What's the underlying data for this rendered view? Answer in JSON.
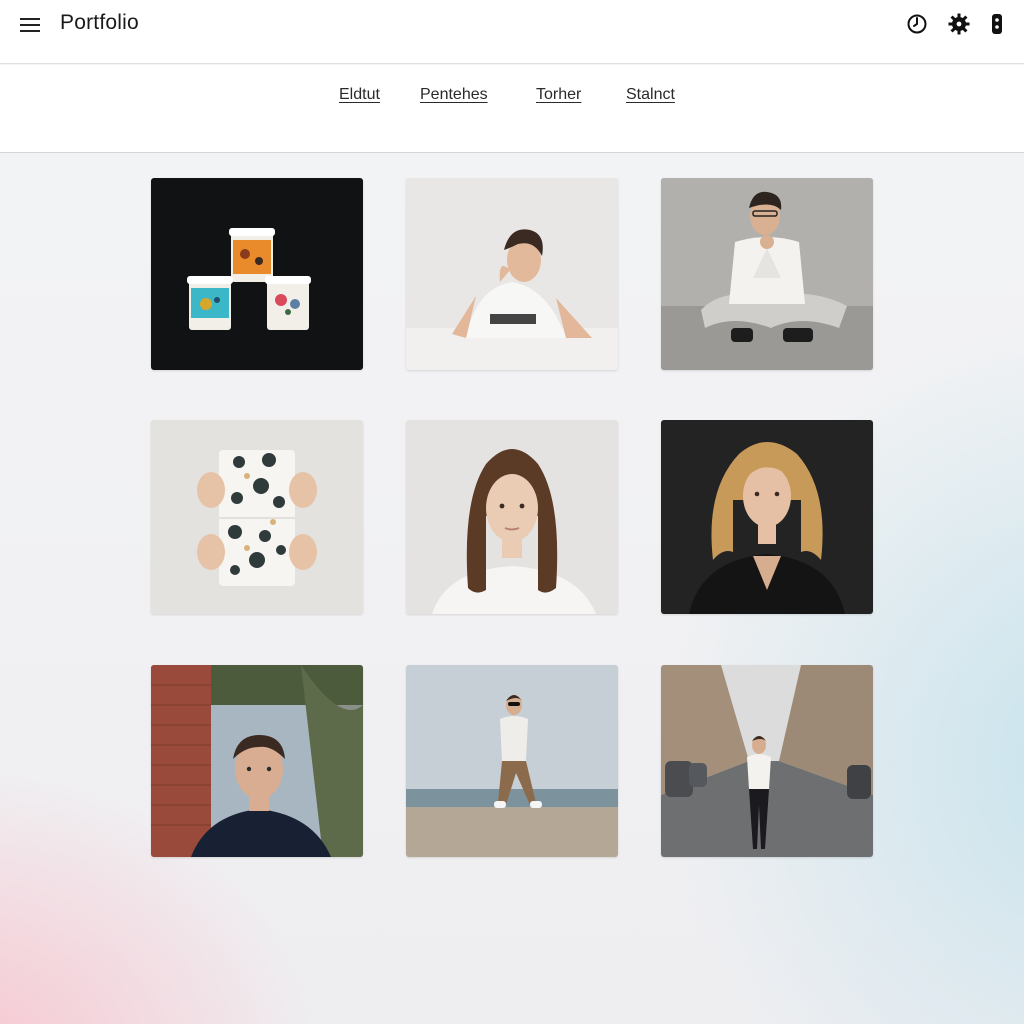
{
  "app": {
    "title": "Portfolio"
  },
  "header_icons": [
    "menu-icon",
    "clock-icon",
    "settings-gear-icon",
    "more-options-icon"
  ],
  "subnav": {
    "links": [
      "Eldtut",
      "Pentehes",
      "Torher",
      "Stalnct"
    ]
  },
  "gallery": {
    "items": [
      {
        "subject": "three-paper-cups",
        "background": "#111315"
      },
      {
        "subject": "young-man-white-tshirt",
        "background": "#e7e6e4"
      },
      {
        "subject": "man-sitting-cross-legged",
        "background": "#a9a8a5"
      },
      {
        "subject": "hands-holding-patterned-cards",
        "background": "#e2e1de"
      },
      {
        "subject": "woman-portrait-light",
        "background": "#e4e3e1"
      },
      {
        "subject": "woman-portrait-dark",
        "background": "#222222"
      },
      {
        "subject": "man-by-brick-wall",
        "background": "#6a6f6b"
      },
      {
        "subject": "woman-on-beach",
        "background": "#c7d0d6"
      },
      {
        "subject": "woman-on-city-street",
        "background": "#b6b8b8"
      }
    ]
  },
  "colors": {
    "header_bg": "#ffffff",
    "page_bg": "#f2f2f4",
    "text": "#1a1a1a",
    "accent_pink": "#f8c4ce",
    "accent_blue": "#c4e2ec"
  }
}
